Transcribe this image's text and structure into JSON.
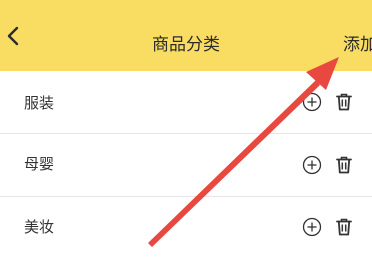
{
  "navbar": {
    "title": "商品分类",
    "add_label": "添加",
    "back_icon": "chevron-left-icon",
    "background": "#f9dc62"
  },
  "categories": [
    {
      "label": "服装",
      "add_icon": "circle-plus-icon",
      "delete_icon": "trash-icon"
    },
    {
      "label": "母婴",
      "add_icon": "circle-plus-icon",
      "delete_icon": "trash-icon"
    },
    {
      "label": "美妆",
      "add_icon": "circle-plus-icon",
      "delete_icon": "trash-icon"
    }
  ],
  "annotation": {
    "arrow_color": "#e8483f",
    "arrow_icon": "red-arrow-annotation"
  }
}
